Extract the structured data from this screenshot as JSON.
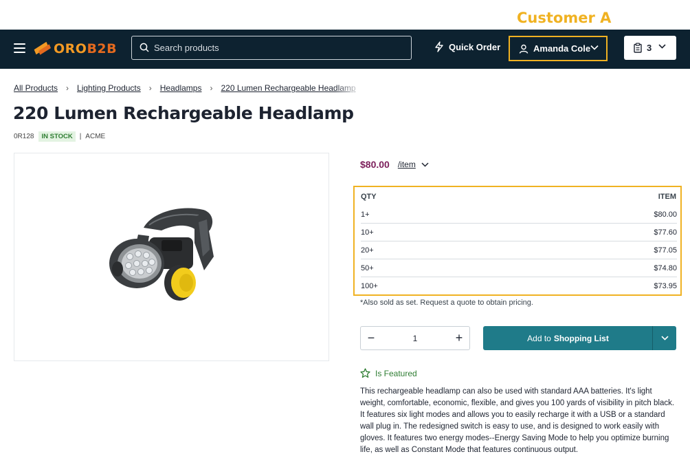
{
  "annotation": "Customer A",
  "header": {
    "logo": {
      "part1": "ORO",
      "part2": "B2B"
    },
    "search": {
      "placeholder": "Search products"
    },
    "quick_order": "Quick Order",
    "customer_name": "Amanda Cole",
    "cart_count": "3"
  },
  "breadcrumbs": [
    "All Products",
    "Lighting Products",
    "Headlamps",
    "220 Lumen Rechargeable Headlamp"
  ],
  "product": {
    "title": "220 Lumen Rechargeable Headlamp",
    "sku": "0R128",
    "stock": "IN STOCK",
    "brand": "ACME",
    "price": "$80.00",
    "unit": "/item"
  },
  "tier_table": {
    "headers": {
      "qty": "QTY",
      "unit": "ITEM"
    },
    "rows": [
      {
        "qty": "1+",
        "price": "$80.00"
      },
      {
        "qty": "10+",
        "price": "$77.60"
      },
      {
        "qty": "20+",
        "price": "$77.05"
      },
      {
        "qty": "50+",
        "price": "$74.80"
      },
      {
        "qty": "100+",
        "price": "$73.95"
      }
    ]
  },
  "note": "*Also sold as set. Request a quote to obtain pricing.",
  "quantity": "1",
  "add_button": {
    "prefix": "Add to",
    "target": "Shopping List"
  },
  "featured_label": "Is Featured",
  "description": "This rechargeable headlamp can also be used with standard AAA batteries. It's light weight, comfortable, economic, flexible, and gives you 100 yards of visibility in pitch black. It features six light modes and allows you to easily recharge it with a USB or a standard wall plug in. The redesigned switch is easy to use, and is designed to work easily with gloves. It features two energy modes--Energy Saving Mode to help you optimize burning life, as well as Constant Mode that features continuous output.",
  "colors": {
    "header_bg": "#0d2230",
    "accent": "#f0b222",
    "button": "#1f7b89",
    "price": "#7c1f5b",
    "stock": "#2e7d32"
  },
  "icons": [
    "menu-icon",
    "search-icon",
    "lightning-icon",
    "user-icon",
    "chevron-down-icon",
    "clipboard-icon",
    "chevron-right-icon",
    "star-icon",
    "minus-icon",
    "plus-icon"
  ]
}
